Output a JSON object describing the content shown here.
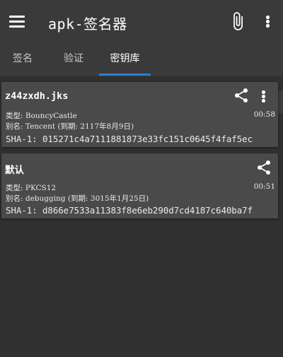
{
  "app_title": "apk-签名器",
  "toolbar": {
    "menu_icon": "menu-icon",
    "attach_icon": "paperclip-icon",
    "more_icon": "more-vert-icon"
  },
  "tabs": [
    {
      "label": "签名",
      "active": false
    },
    {
      "label": "验证",
      "active": false
    },
    {
      "label": "密钥库",
      "active": true
    }
  ],
  "accent_color": "#2b7fd3",
  "keystores": [
    {
      "name": "z44zxdh.jks",
      "type_line": "类型: BouncyCastle",
      "alias_line": "别名: Tencent (到期: 2117年8月9日)",
      "time": "00:58",
      "sha1": "SHA-1: 015271c4a7111881873e33fc151c0645f4faf5ec",
      "actions": [
        "share-icon",
        "more-vert-icon"
      ]
    },
    {
      "name": "默认",
      "type_line": "类型: PKCS12",
      "alias_line": "别名: debugging (到期: 3015年1月25日)",
      "time": "00:51",
      "sha1": "SHA-1: d866e7533a11383f8e6eb290d7cd4187c640ba7f",
      "actions": [
        "share-icon"
      ]
    }
  ]
}
